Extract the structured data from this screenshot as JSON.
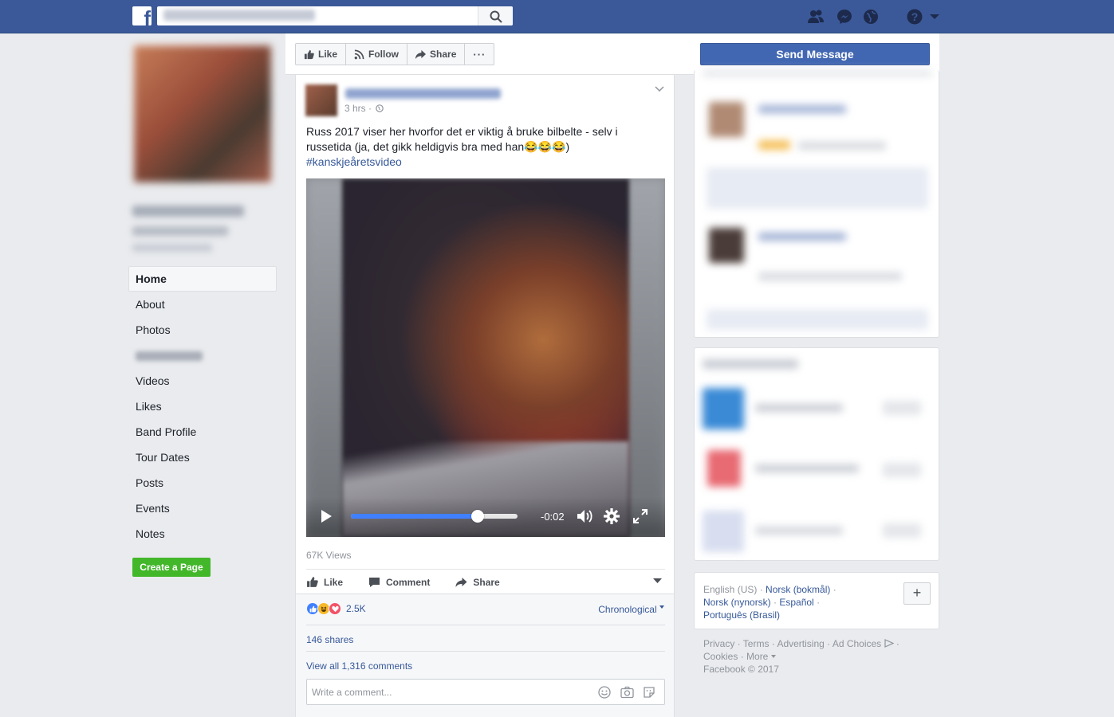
{
  "topbar": {
    "logo": "f"
  },
  "left_nav": {
    "items": [
      {
        "label": "Home",
        "active": true
      },
      {
        "label": "About"
      },
      {
        "label": "Photos"
      },
      {
        "label": ""
      },
      {
        "label": "Videos"
      },
      {
        "label": "Likes"
      },
      {
        "label": "Band Profile"
      },
      {
        "label": "Tour Dates"
      },
      {
        "label": "Posts"
      },
      {
        "label": "Events"
      },
      {
        "label": "Notes"
      }
    ],
    "create_page": "Create a Page"
  },
  "action_bar": {
    "like": "Like",
    "follow": "Follow",
    "share": "Share",
    "more": "···",
    "send_message": "Send Message"
  },
  "post": {
    "time": "3 hrs ·",
    "text": "Russ 2017 viser her hvorfor det er viktig å bruke bilbelte - selv i russetida (ja, det gikk heldigvis bra med han😂😂😂)",
    "hashtag": "#kanskjeåretsvideo",
    "video": {
      "time_remaining": "-0:02",
      "progress": 0.76
    },
    "views": "67K Views",
    "actions": {
      "like": "Like",
      "comment": "Comment",
      "share": "Share"
    },
    "reactions_count": "2.5K",
    "sort": "Chronological",
    "shares": "146 shares",
    "view_comments": "View all 1,316 comments",
    "comment_placeholder": "Write a comment..."
  },
  "languages": {
    "current": "English (US) ·",
    "norsk_bokmal": "Norsk (bokmål)",
    "norsk_nynorsk": "Norsk (nynorsk)",
    "espanol": "Español",
    "portugues": "Português (Brasil)"
  },
  "footer": {
    "line1": "Privacy · Terms · Advertising · Ad Choices",
    "line2": "Cookies · More",
    "copyright": "Facebook © 2017"
  },
  "colors": {
    "brand": "#3b5998",
    "button_blue": "#4267b2",
    "link": "#365899",
    "green": "#42b72a"
  }
}
